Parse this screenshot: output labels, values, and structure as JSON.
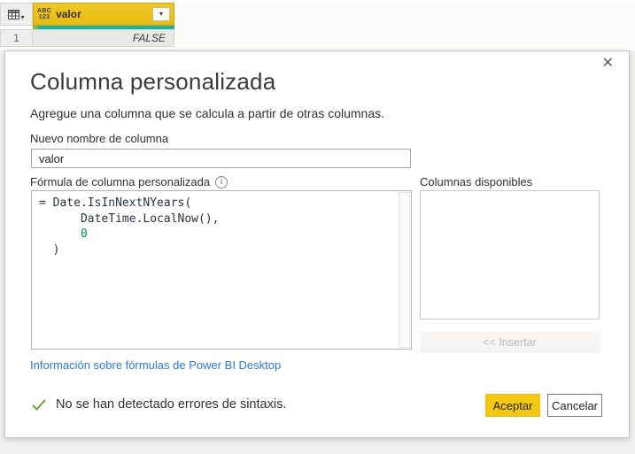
{
  "preview_table": {
    "corner_dropdown_icon": "▾",
    "column_header": {
      "type_icon_top": "ABC",
      "type_icon_bottom": "123",
      "name": "valor",
      "dropdown_icon": "▾"
    },
    "rows": [
      {
        "num": "1",
        "value": "FALSE"
      }
    ]
  },
  "dialog": {
    "close_icon": "✕",
    "title": "Columna personalizada",
    "subtitle": "Agregue una columna que se calcula a partir de otras columnas.",
    "name_field": {
      "label": "Nuevo nombre de columna",
      "value": "valor"
    },
    "formula_section": {
      "label": "Fórmula de columna personalizada",
      "info_icon": "i",
      "code_lines": [
        [
          {
            "t": "= Date.IsInNextNYears(",
            "c": "default"
          }
        ],
        [
          {
            "t": "      DateTime.LocalNow(),",
            "c": "default"
          }
        ],
        [
          {
            "t": "      ",
            "c": "default"
          },
          {
            "t": "0",
            "c": "number"
          }
        ],
        [
          {
            "t": "  )",
            "c": "default"
          }
        ]
      ]
    },
    "available_columns": {
      "label": "Columnas disponibles",
      "items": [],
      "insert_button": "<< Insertar",
      "insert_enabled": false
    },
    "help_link": "Información sobre fórmulas de Power BI Desktop",
    "status": {
      "text": "No se han detectado errores de sintaxis.",
      "ok": true
    },
    "actions": {
      "accept": "Aceptar",
      "cancel": "Cancelar"
    }
  },
  "colors": {
    "accent_yellow": "#f2c811",
    "header_gold": "#eabf1b",
    "quality_bar_teal": "#17b1a6",
    "quality_bar_green": "#76bf3f",
    "link_blue": "#2b7cd3",
    "status_green": "#67a33e",
    "code_number_green": "#098658"
  }
}
